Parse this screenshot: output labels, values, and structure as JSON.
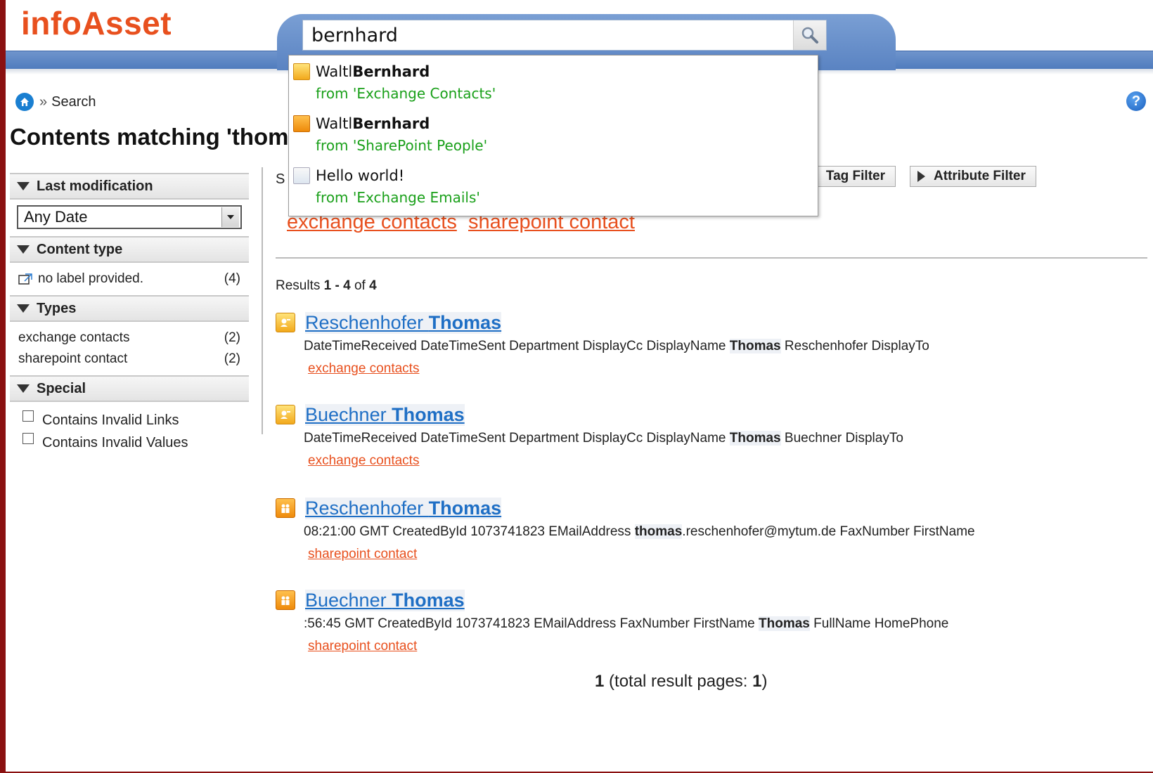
{
  "header": {
    "logo": "infoAsset",
    "search": {
      "value": "bernhard"
    }
  },
  "breadcrumb": {
    "current": "Search",
    "separator": "»"
  },
  "page_title": "Contents matching 'thoma",
  "sidebar": {
    "last_modification": {
      "label": "Last modification",
      "selected": "Any Date"
    },
    "content_type": {
      "label": "Content type",
      "items": [
        {
          "label": "no label provided.",
          "count": "(4)"
        }
      ]
    },
    "types": {
      "label": "Types",
      "items": [
        {
          "label": "exchange contacts",
          "count": "(2)"
        },
        {
          "label": "sharepoint contact",
          "count": "(2)"
        }
      ]
    },
    "special": {
      "label": "Special",
      "items": [
        {
          "label": "Contains Invalid Links"
        },
        {
          "label": "Contains Invalid Values"
        }
      ]
    }
  },
  "main": {
    "partial_left": "S",
    "tag_filter": "Tag Filter",
    "attribute_filter": "Attribute Filter",
    "tags": [
      "exchange contacts",
      "sharepoint contact"
    ],
    "results_count": {
      "prefix": "Results ",
      "start": "1",
      "dash": " - ",
      "end": "4",
      "of": " of ",
      "total": "4"
    },
    "results": [
      {
        "icon": "contact-card-icon",
        "name": "Reschenhofer ",
        "highlight": "Thomas",
        "snippet_pre": "DateTimeReceived DateTimeSent Department DisplayCc DisplayName ",
        "snippet_bold": "Thomas",
        "snippet_post": " Reschenhofer DisplayTo",
        "tag": "exchange contacts"
      },
      {
        "icon": "contact-card-icon",
        "name": "Buechner ",
        "highlight": "Thomas",
        "snippet_pre": "DateTimeReceived DateTimeSent Department DisplayCc DisplayName ",
        "snippet_bold": "Thomas",
        "snippet_post": " Buechner DisplayTo",
        "tag": "exchange contacts"
      },
      {
        "icon": "sharepoint-people-icon",
        "name": "Reschenhofer ",
        "highlight": "Thomas",
        "snippet_pre": "08:21:00 GMT CreatedById 1073741823 EMailAddress ",
        "snippet_bold": "thomas",
        "snippet_post": ".reschenhofer@mytum.de FaxNumber FirstName",
        "tag": "sharepoint contact"
      },
      {
        "icon": "sharepoint-people-icon",
        "name": "Buechner ",
        "highlight": "Thomas",
        "snippet_pre": ":56:45 GMT CreatedById 1073741823 EMailAddress FaxNumber FirstName ",
        "snippet_bold": "Thomas",
        "snippet_post": " FullName HomePhone",
        "tag": "sharepoint contact"
      }
    ],
    "pagination": {
      "page": "1",
      "label_pre": " (total result pages: ",
      "total": "1",
      "label_post": ")"
    }
  },
  "autocomplete": [
    {
      "icon": "contact-card-icon",
      "name": "Waltl ",
      "bold": "Bernhard",
      "source": "from 'Exchange Contacts'"
    },
    {
      "icon": "sharepoint-people-icon",
      "name": "Waltl ",
      "bold": "Bernhard",
      "source": "from 'SharePoint People'"
    },
    {
      "icon": "email-icon",
      "name": "Hello world!",
      "bold": "",
      "source": "from 'Exchange Emails'"
    }
  ]
}
